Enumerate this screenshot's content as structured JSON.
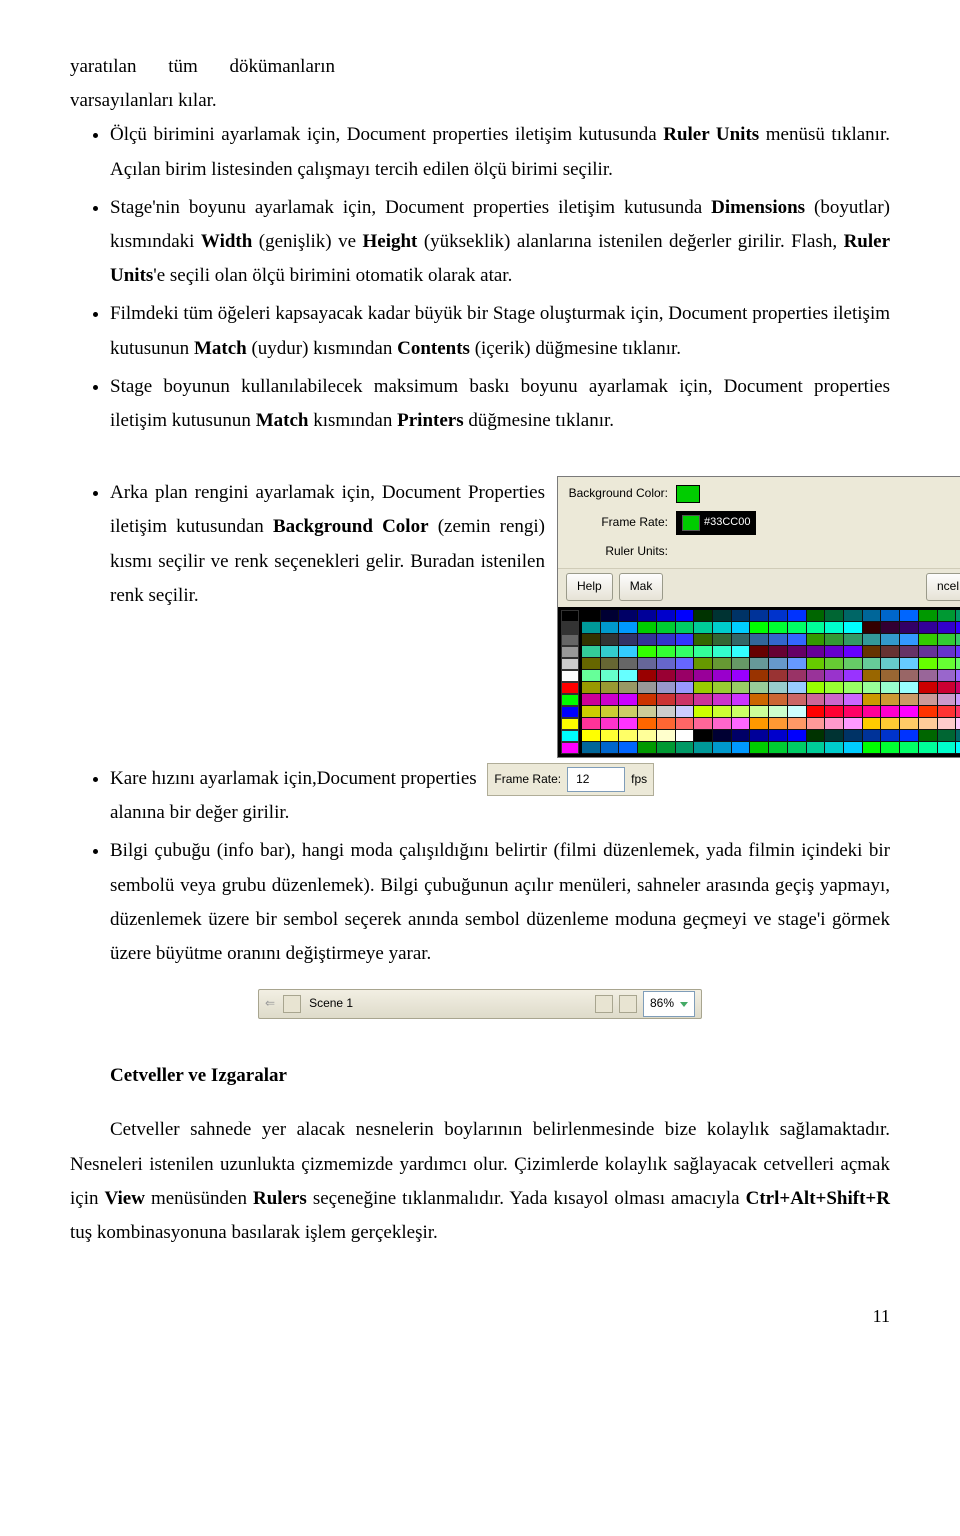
{
  "intro_line1_w1": "yaratılan",
  "intro_line1_w2": "tüm",
  "intro_line1_w3": "dökümanların",
  "intro_line2": "varsayılanları kılar.",
  "bullets": [
    "Ölçü birimini ayarlamak için, Document properties iletişim kutusunda <b>Ruler Units</b> menüsü tıklanır. Açılan birim listesinden çalışmayı tercih edilen ölçü birimi seçilir.",
    "Stage'nin boyunu ayarlamak için, Document properties iletişim kutusunda <b>Dimensions</b> (boyutlar) kısmındaki <b>Width</b> (genişlik) ve <b>Height</b> (yükseklik) alanlarına istenilen değerler girilir. Flash, <b>Ruler Units</b>'e seçili olan ölçü birimini otomatik olarak atar.",
    "Filmdeki tüm öğeleri kapsayacak kadar büyük bir Stage oluşturmak için, Document properties iletişim kutusunun <b>Match</b> (uydur) kısmından <b>Contents</b> (içerik) düğmesine tıklanır.",
    "Stage boyunun kullanılabilecek maksimum baskı boyunu ayarlamak için, Document properties iletişim kutusunun <b>Match</b> kısmından <b>Printers</b> düğmesine tıklanır."
  ],
  "bullets2_block1": "Arka plan rengini ayarlamak için, Document Properties iletişim  kutusundan <b>Background Color</b> (zemin rengi) kısmı seçilir ve renk seçenekleri gelir. Buradan istenilen renk seçilir.",
  "bullets2_item2_a": "Kare hızını ayarlamak için,Document properties",
  "bullets2_item2_b": "alanına bir değer girilir.",
  "bullets2_item3": "Bilgi çubuğu (info bar), hangi moda çalışıldığını belirtir (filmi düzenlemek, yada filmin içindeki bir sembolü veya grubu düzenlemek). Bilgi çubuğunun açılır menüleri, sahneler arasında geçiş yapmayı, düzenlemek üzere bir sembol seçerek anında sembol  düzenleme moduna geçmeyi ve stage'i görmek üzere büyütme oranını değiştirmeye yarar.",
  "cp": {
    "bgcolor": "Background Color:",
    "framerate": "Frame Rate:",
    "rulerunits": "Ruler Units:",
    "hex": "#33CC00",
    "help": "Help",
    "make": "Mak",
    "cancel": "ncel"
  },
  "fr": {
    "label": "Frame Rate:",
    "value": "12",
    "unit": "fps"
  },
  "scene": {
    "label": "Scene 1",
    "zoom": "86%"
  },
  "heading": "Cetveller ve Izgaralar",
  "para": "Cetveller sahnede yer alacak nesnelerin boylarının belirlenmesinde bize kolaylık sağlamaktadır. Nesneleri istenilen uzunlukta çizmemizde yardımcı olur. Çizimlerde kolaylık sağlayacak cetvelleri açmak için <b>View</b> menüsünden <b>Rulers</b> seçeneğine tıklanmalıdır. Yada kısayol olması amacıyla <b>Ctrl+Alt+Shift+R</b> tuş kombinasyonuna basılarak işlem gerçekleşir.",
  "pagenum": "11"
}
